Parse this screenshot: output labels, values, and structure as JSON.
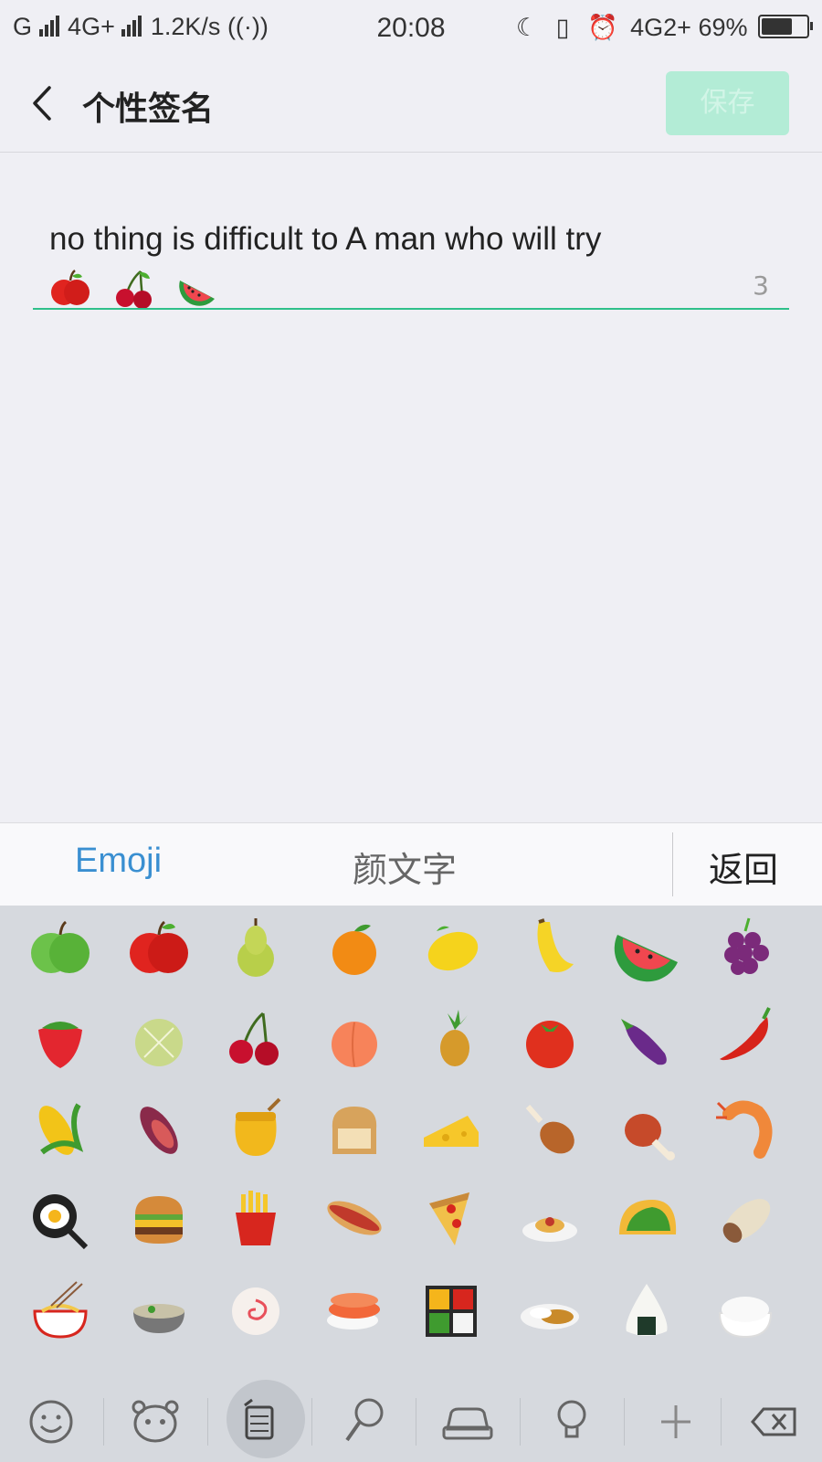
{
  "status_bar": {
    "left": "G",
    "network": "4G+",
    "speed": "1.2K/s",
    "time": "20:08",
    "network2": "4G2+",
    "battery": "69%",
    "battery_level": 0.69
  },
  "header": {
    "title": "个性签名",
    "save_label": "保存"
  },
  "signature": {
    "text": "no  thing is  difficult to A man who will try",
    "emojis": [
      "apple-red",
      "cherries",
      "watermelon"
    ],
    "counter": "3"
  },
  "tabs": {
    "emoji": "Emoji",
    "kaomoji": "颜文字",
    "back": "返回"
  },
  "emoji_grid": [
    [
      "apple-green",
      "apple-red",
      "pear",
      "tangerine",
      "lemon",
      "banana",
      "watermelon",
      "grapes"
    ],
    [
      "strawberry",
      "melon",
      "cherries",
      "peach",
      "pineapple",
      "tomato",
      "eggplant",
      "hot-pepper"
    ],
    [
      "corn",
      "sweet-potato",
      "honey-pot",
      "bread",
      "cheese",
      "poultry-leg",
      "meat-on-bone",
      "fried-shrimp"
    ],
    [
      "cooking-egg",
      "hamburger",
      "fries",
      "hotdog",
      "pizza",
      "spaghetti",
      "taco",
      "burrito"
    ],
    [
      "ramen",
      "stew",
      "fish-cake",
      "sushi",
      "bento",
      "curry-rice",
      "rice-ball",
      "cooked-rice"
    ]
  ],
  "categories": [
    "smiley",
    "animal",
    "food",
    "sports",
    "travel",
    "objects",
    "symbols",
    "delete"
  ],
  "colors": {
    "accent_green": "#2fc08a",
    "save_bg": "#b3ecd6",
    "tab_blue": "#3a8fd1",
    "keyboard_bg": "#d6d9de"
  }
}
